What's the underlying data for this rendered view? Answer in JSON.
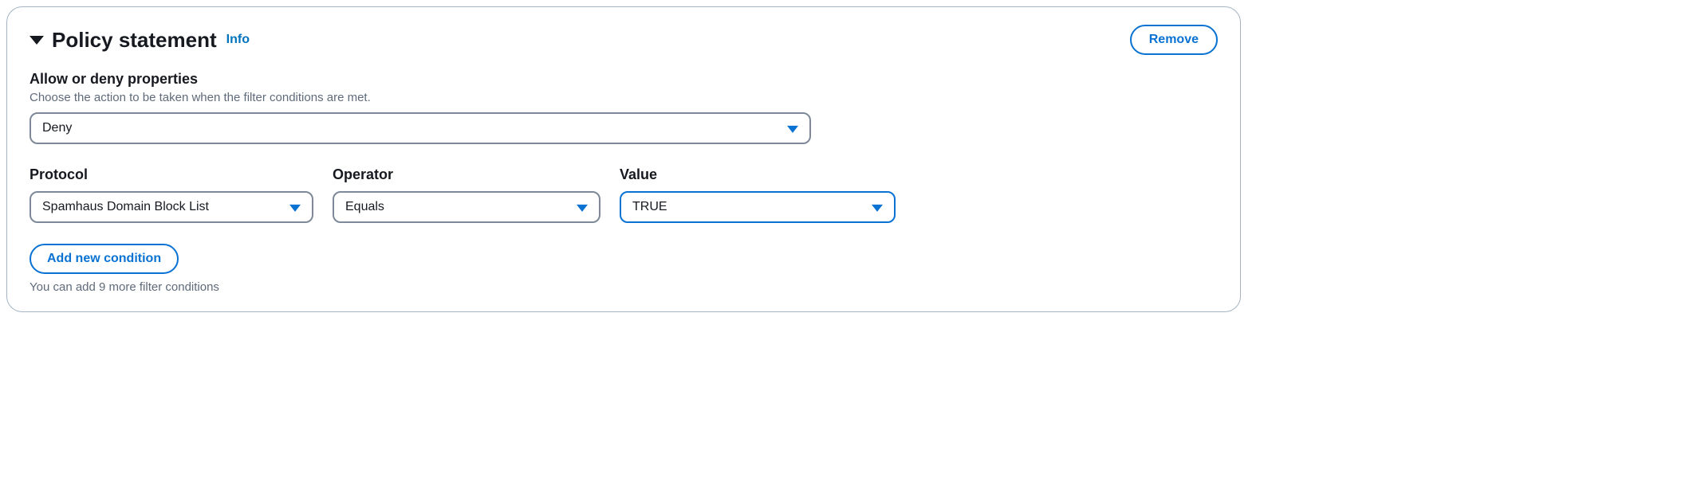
{
  "header": {
    "title": "Policy statement",
    "info": "Info",
    "remove": "Remove"
  },
  "action": {
    "label": "Allow or deny properties",
    "description": "Choose the action to be taken when the filter conditions are met.",
    "value": "Deny"
  },
  "condition": {
    "protocol": {
      "label": "Protocol",
      "value": "Spamhaus Domain Block List"
    },
    "operator": {
      "label": "Operator",
      "value": "Equals"
    },
    "value": {
      "label": "Value",
      "value": "TRUE"
    }
  },
  "footer": {
    "add": "Add new condition",
    "hint": "You can add 9 more filter conditions"
  }
}
